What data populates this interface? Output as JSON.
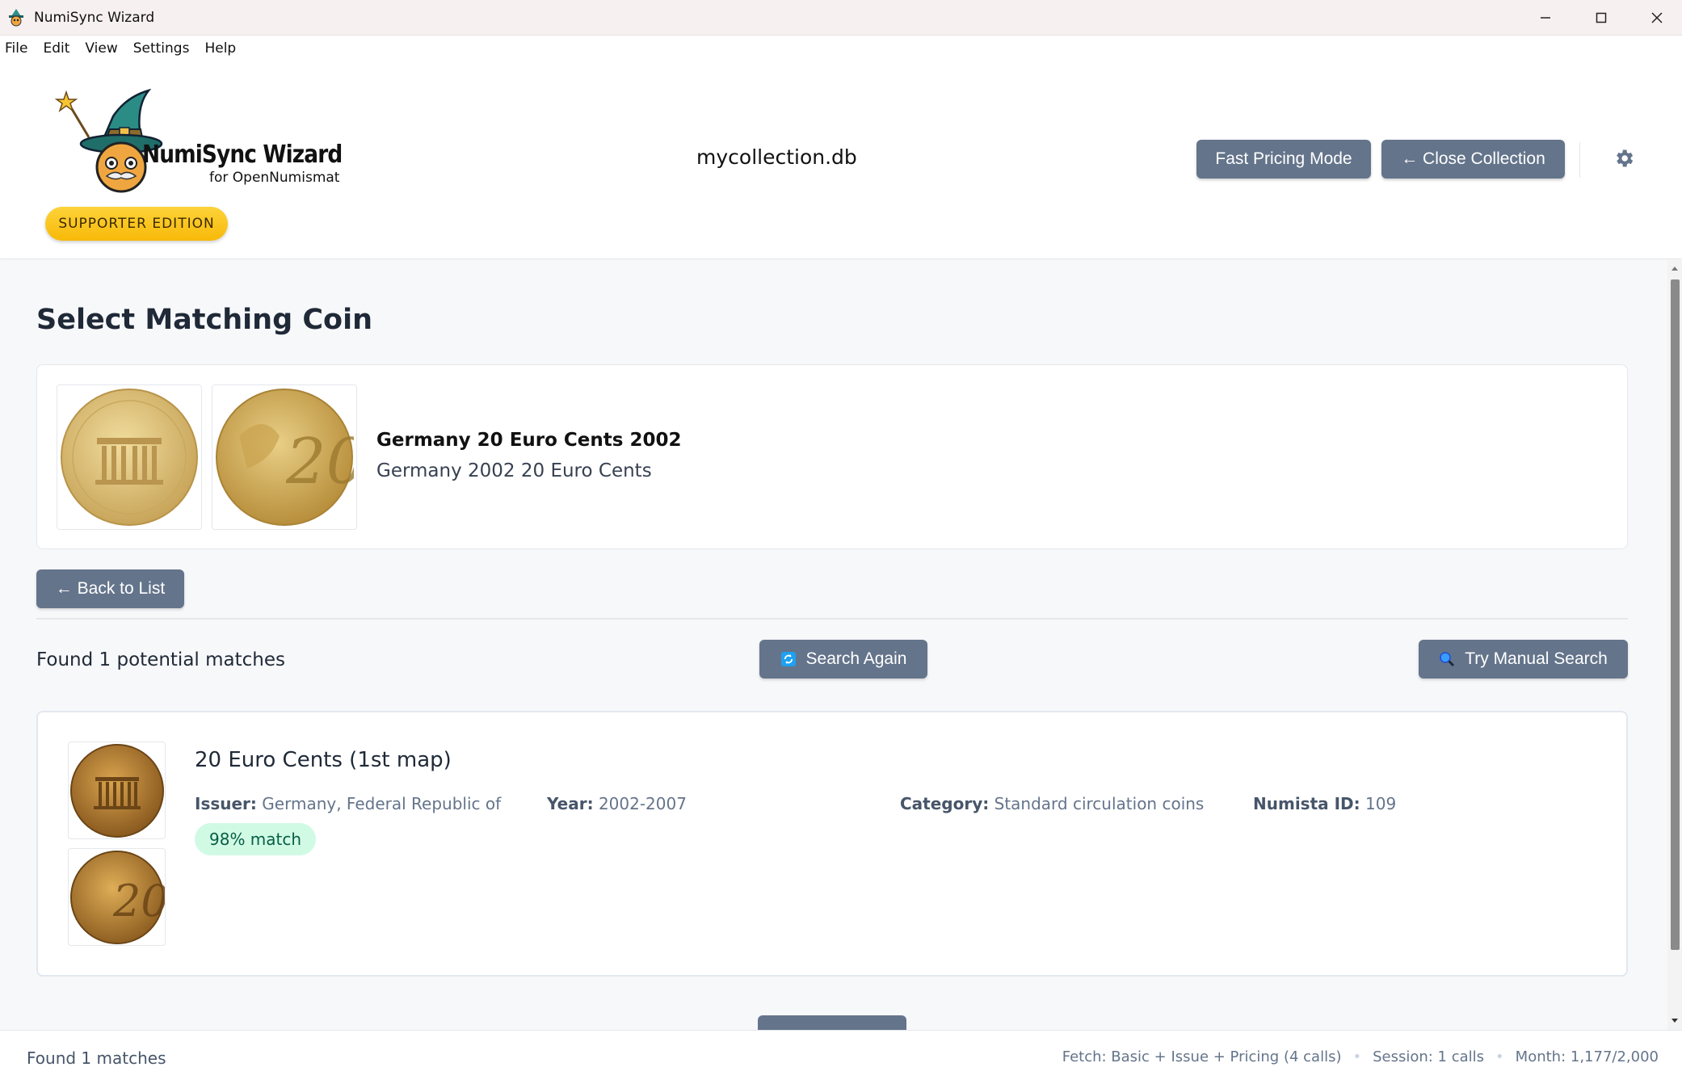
{
  "window": {
    "title": "NumiSync Wizard"
  },
  "menu": [
    "File",
    "Edit",
    "View",
    "Settings",
    "Help"
  ],
  "header": {
    "logo_title": "NumiSync Wizard",
    "logo_subtitle": "for OpenNumismat",
    "edition_badge": "SUPPORTER EDITION",
    "db_name": "mycollection.db",
    "fast_pricing_label": "Fast Pricing Mode",
    "close_collection_label": "← Close Collection"
  },
  "main": {
    "page_title": "Select Matching Coin",
    "coin": {
      "title": "Germany 20 Euro Cents 2002",
      "subtitle": "Germany 2002 20 Euro Cents"
    },
    "back_label": "← Back to List",
    "found_text": "Found 1 potential matches",
    "search_again_label": "Search Again",
    "manual_search_label": "Try Manual Search",
    "matches": [
      {
        "title": "20 Euro Cents (1st map)",
        "issuer_label": "Issuer:",
        "issuer": "Germany, Federal Republic of",
        "year_label": "Year:",
        "year": "2002-2007",
        "category_label": "Category:",
        "category": "Standard circulation coins",
        "numista_label": "Numista ID:",
        "numista_id": "109",
        "match": "98% match"
      }
    ]
  },
  "status": {
    "left": "Found 1 matches",
    "fetch": "Fetch: Basic + Issue + Pricing (4 calls)",
    "session": "Session: 1 calls",
    "month": "Month: 1,177/2,000"
  },
  "colors": {
    "button": "#64748b",
    "badge": "#fcc419",
    "match_badge_bg": "#d1fae5",
    "match_badge_text": "#065f46"
  }
}
